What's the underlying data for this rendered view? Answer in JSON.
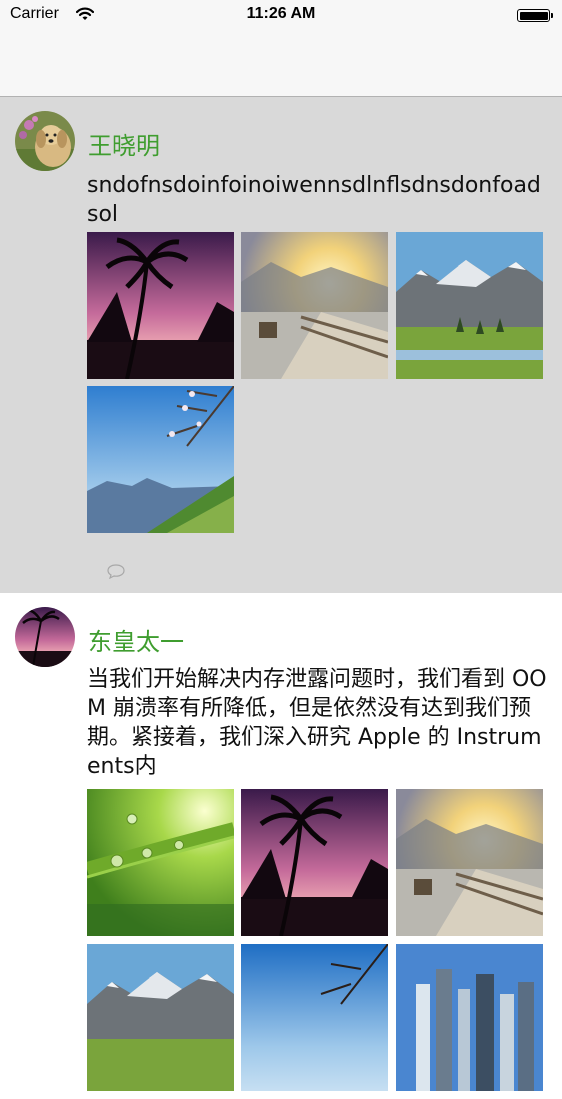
{
  "status_bar": {
    "carrier": "Carrier",
    "time": "11:26 AM"
  },
  "posts": [
    {
      "name": "王晓明",
      "content": "sndofnsdoinfoinoiwennsdlnflsdnsdonfoadsol",
      "avatar": "dog-photo",
      "images": [
        "palm-sunset",
        "sunny-boardwalk",
        "snowy-mountain-lake",
        "blossom-sea"
      ]
    },
    {
      "name": "东皇太一",
      "content": "当我们开始解决内存泄露问题时，我们看到 OOM 崩溃率有所降低，但是依然没有达到我们预期。紧接着，我们深入研究 Apple 的 Instruments内",
      "avatar": "palm-sunset",
      "images": [
        "water-droplets-leaf",
        "palm-sunset",
        "sunny-boardwalk",
        "snowy-mountain-lake",
        "blossom-sea",
        "city-skyline"
      ]
    }
  ],
  "icons": {
    "comment": "speech-bubble-icon",
    "wifi": "wifi-icon",
    "battery": "battery-icon"
  },
  "colors": {
    "name": "#3f9d2f",
    "selected_bg": "#d9d9d9"
  }
}
